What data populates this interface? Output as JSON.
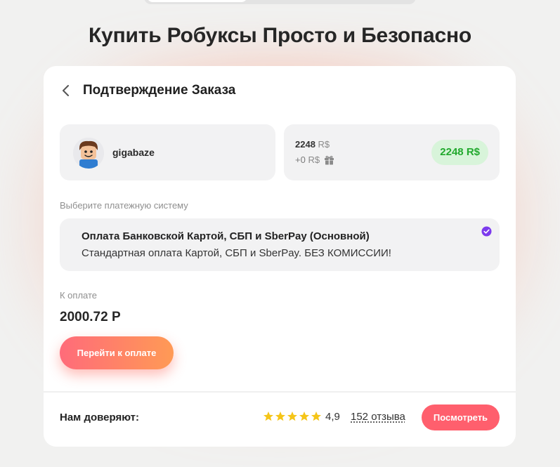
{
  "colors": {
    "accent_gradient_start": "#ff6b7a",
    "accent_gradient_end": "#ff9a55",
    "badge_green": "#22a92e",
    "check_purple": "#7c3aed",
    "star_yellow": "#f5c518"
  },
  "page": {
    "title": "Купить Робуксы Просто и Безопасно"
  },
  "order": {
    "title": "Подтверждение Заказа",
    "back_icon": "chevron-left-icon",
    "user": {
      "avatar_icon": "roblox-avatar",
      "username": "gigabaze"
    },
    "amount": {
      "main_value": "2248",
      "currency": "R$",
      "bonus_value": "+0",
      "bonus_icon": "gift-icon",
      "badge": "2248 R$"
    },
    "payment": {
      "caption": "Выберите платежную систему",
      "option_name": "Оплата Банковской Картой, СБП и SberPay (Основной)",
      "option_desc": "Стандартная оплата Картой, СБП и SberPay. БЕЗ КОМИССИИ!",
      "selected_icon": "check-circle-icon"
    },
    "to_pay": {
      "label": "К оплате",
      "value": "2000.72 Р"
    },
    "pay_button": "Перейти к оплате"
  },
  "trust": {
    "label": "Нам доверяют:",
    "stars": 5,
    "rating": "4,9",
    "reviews": "152 отзыва",
    "view_button": "Посмотреть"
  }
}
